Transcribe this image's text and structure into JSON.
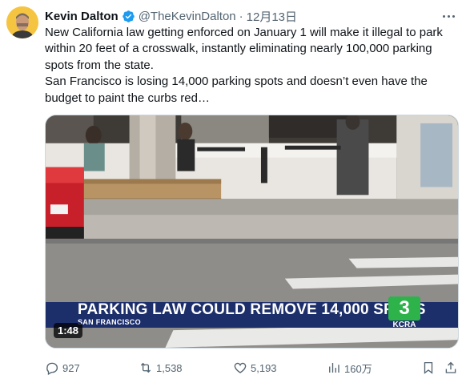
{
  "author": {
    "name": "Kevin Dalton",
    "handle": "@TheKevinDalton",
    "separator": "·",
    "date": "12月13日"
  },
  "tweet": {
    "paragraph1": "New California law getting enforced on January 1 will make it illegal to park within 20 feet of a crosswalk, instantly eliminating nearly 100,000 parking spots from the state.",
    "paragraph2": "San Francisco is losing 14,000 parking spots and doesn’t even have the budget to paint the curbs red…"
  },
  "video": {
    "headline": "PARKING LAW COULD REMOVE 14,000 SPOTS",
    "location": "SAN FRANCISCO",
    "channel_number": "3",
    "channel_callsign": "KCRA",
    "duration": "1:48"
  },
  "stats": {
    "replies": "927",
    "reposts": "1,538",
    "likes": "5,193",
    "views": "160万"
  },
  "colors": {
    "text_primary": "#0f1419",
    "text_secondary": "#536471",
    "verified_blue": "#1d9bf0",
    "banner_navy": "#1d2f6b",
    "kcra_green": "#2db34a"
  },
  "icons": [
    "verified-badge-icon",
    "more-icon",
    "reply-icon",
    "repost-icon",
    "like-icon",
    "views-icon",
    "bookmark-icon",
    "share-icon"
  ]
}
